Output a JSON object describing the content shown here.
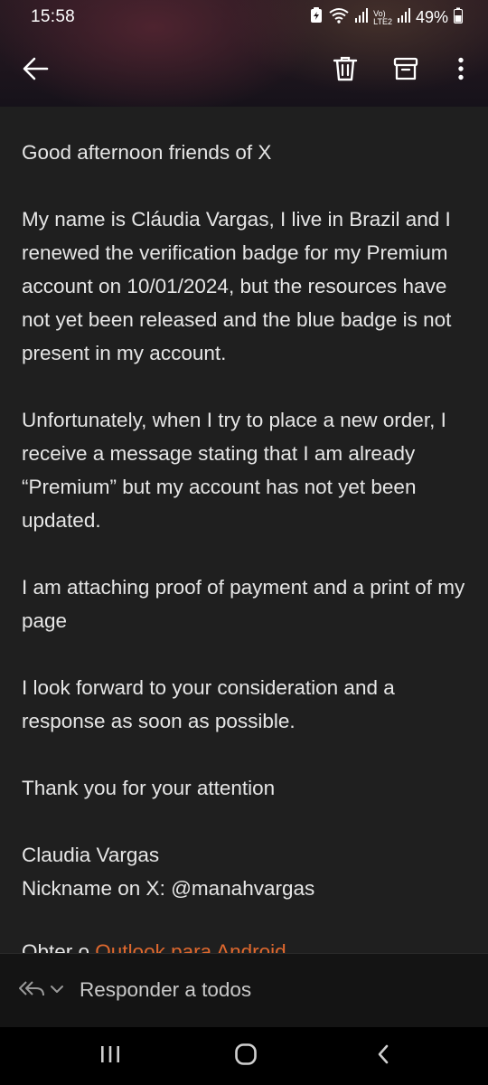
{
  "status_bar": {
    "time": "15:58",
    "battery": "49%",
    "network_label": "LTE2",
    "icons": [
      "battery-saver-icon",
      "wifi-icon",
      "cell-signal-icon",
      "volte-icon",
      "cell-signal-icon",
      "battery-icon"
    ]
  },
  "toolbar": {
    "icons": [
      "back-arrow-icon",
      "trash-icon",
      "archive-icon",
      "more-vert-icon"
    ]
  },
  "email": {
    "paragraphs": [
      "Good afternoon friends of X",
      "My name is Cláudia Vargas, I live in Brazil and I renewed the verification badge for my Premium account on 10/01/2024, but the resources have not yet been released and the blue badge is not present in my account.",
      "Unfortunately, when I try to place a new order, I receive a message stating that I am already “Premium” but my account has not yet been updated.",
      "I am attaching proof of payment and a print of my page",
      "I look forward to your consideration and a response as soon as possible.",
      "Thank you for your attention"
    ],
    "signature_name": "Claudia Vargas",
    "signature_nickname": "Nickname on X: @manahvargas",
    "footer_prefix": "Obter o ",
    "footer_link": "Outlook para Android"
  },
  "reply_bar": {
    "label": "Responder a todos",
    "icons": [
      "reply-all-icon",
      "chevron-down-icon"
    ]
  },
  "nav_bar": {
    "icons": [
      "recent-apps-icon",
      "home-icon",
      "back-nav-icon"
    ]
  },
  "colors": {
    "background": "#1f1f1f",
    "text": "#e6e6e6",
    "link": "#e0692e",
    "reply_bar": "#141414",
    "nav_bar": "#000000"
  }
}
